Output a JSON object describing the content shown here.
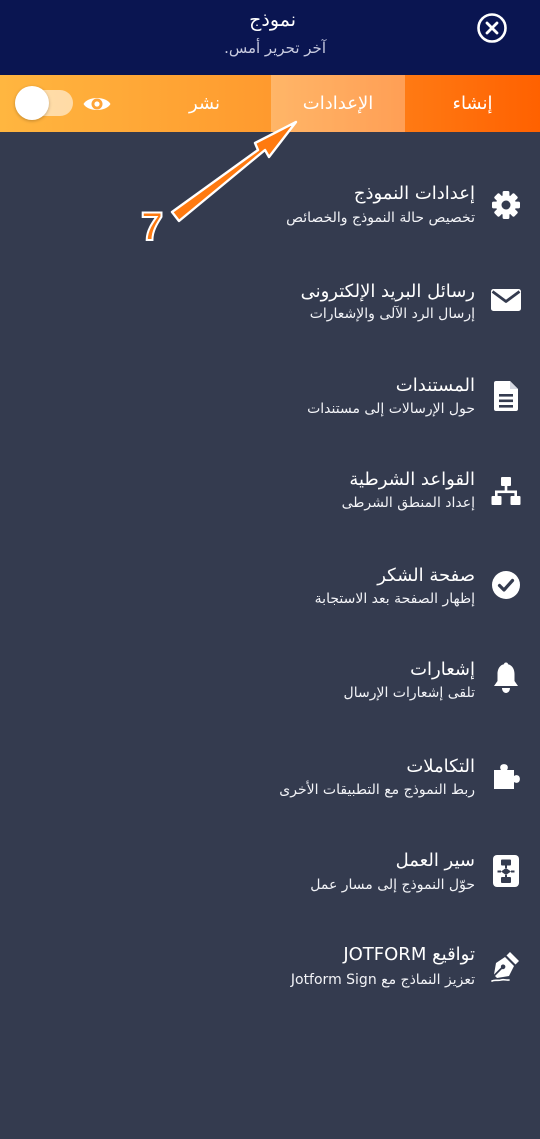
{
  "header": {
    "title": "نموذج",
    "subtitle": "آخر تحرير أمس."
  },
  "tabs": {
    "create": "إنشاء",
    "settings": "الإعدادات",
    "publish": "نشر"
  },
  "icons": {
    "close": "close-icon",
    "preview": "eye-icon"
  },
  "menu": [
    {
      "title": "إعدادات النموذج",
      "subtitle": "تخصيص حالة النموذج والخصائص",
      "icon": "gear-icon"
    },
    {
      "title": "رسائل البريد الإلكترونى",
      "subtitle": "إرسال الرد الآلى والإشعارات",
      "icon": "envelope-icon"
    },
    {
      "title": "المستندات",
      "subtitle": "حول الإرسالات إلى مستندات",
      "icon": "document-icon"
    },
    {
      "title": "القواعد الشرطية",
      "subtitle": "إعداد المنطق الشرطى",
      "icon": "sitemap-icon"
    },
    {
      "title": "صفحة الشكر",
      "subtitle": "إظهار الصفحة بعد الاستجابة",
      "icon": "check-circle-icon"
    },
    {
      "title": "إشعارات",
      "subtitle": "تلقى إشعارات الإرسال",
      "icon": "bell-icon"
    },
    {
      "title": "التكاملات",
      "subtitle": "ربط النموذج مع التطبيقات الأخرى",
      "icon": "puzzle-icon"
    },
    {
      "title": "سير العمل",
      "subtitle": "حوّل النموذج إلى مسار عمل",
      "icon": "workflow-icon"
    },
    {
      "title": "تواقيع JOTFORM",
      "subtitle": "تعزيز النماذج مع Jotform Sign",
      "icon": "pen-nib-icon"
    }
  ],
  "annotation": {
    "step": "7"
  },
  "colors": {
    "header_bg": "#0a1551",
    "body_bg": "#343b4f",
    "accent_orange": "#ff6100",
    "accent_yellow": "#ffb640"
  }
}
